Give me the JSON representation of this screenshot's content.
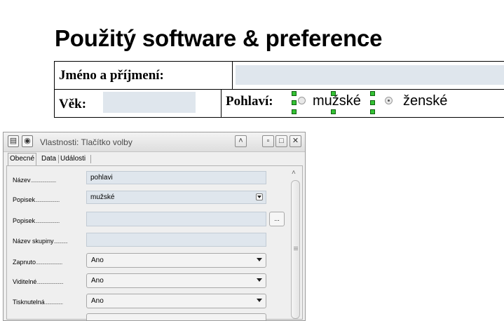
{
  "document": {
    "title": "Použitý software & preference",
    "name_label": "Jméno a příjmení:",
    "age_label": "Věk:",
    "gender_label": "Pohlaví:",
    "radio_options": [
      "mužské",
      "ženské"
    ]
  },
  "dialog": {
    "title": "Vlastnosti: Tlačítko volby",
    "tabs": [
      "Obecné",
      "Data",
      "Události"
    ],
    "active_tab": "Obecné",
    "properties": [
      {
        "label": "Název",
        "type": "text",
        "value": "pohlavi"
      },
      {
        "label": "Popisek",
        "type": "combo",
        "value": "mužské"
      },
      {
        "label": "Popisek",
        "type": "text-button",
        "value": "",
        "button": "..."
      },
      {
        "label": "Název skupiny",
        "type": "text",
        "value": ""
      },
      {
        "label": "Zapnuto",
        "type": "select",
        "value": "Ano"
      },
      {
        "label": "Viditelné",
        "type": "select",
        "value": "Ano"
      },
      {
        "label": "Tisknutelná",
        "type": "select",
        "value": "Ano"
      }
    ]
  },
  "colors": {
    "field_fill": "#dfe6ed",
    "selection_handle": "#34c234"
  }
}
